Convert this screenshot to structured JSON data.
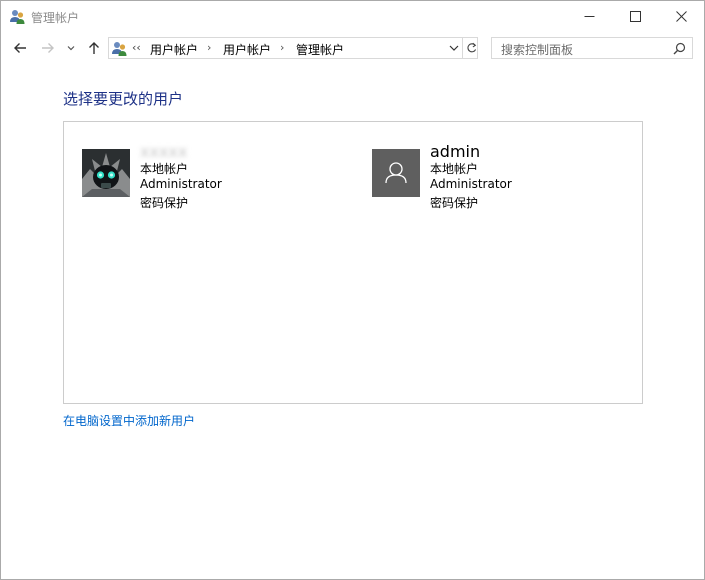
{
  "window": {
    "title": "管理帐户"
  },
  "navigation": {
    "overflow_chevron": "‹‹",
    "breadcrumbs": [
      "用户帐户",
      "用户帐户",
      "管理帐户"
    ],
    "separator": "›"
  },
  "search": {
    "placeholder": "搜索控制面板"
  },
  "content": {
    "heading": "选择要更改的用户",
    "users": [
      {
        "name": "xxxxx",
        "type": "本地帐户",
        "group": "Administrator",
        "protection": "密码保护"
      },
      {
        "name": "admin",
        "type": "本地帐户",
        "group": "Administrator",
        "protection": "密码保护"
      }
    ],
    "add_user_link": "在电脑设置中添加新用户"
  },
  "colors": {
    "heading": "#1e3287",
    "link": "#0066cc",
    "default_avatar_bg": "#5f5f5f",
    "panel_border": "#cccccc"
  },
  "icons": {
    "app": "user-accounts-icon",
    "back": "arrow-left-icon",
    "forward": "arrow-right-icon",
    "recent": "chevron-down-icon",
    "up": "arrow-up-icon",
    "refresh": "refresh-icon",
    "search": "search-icon",
    "default_user": "person-icon"
  }
}
